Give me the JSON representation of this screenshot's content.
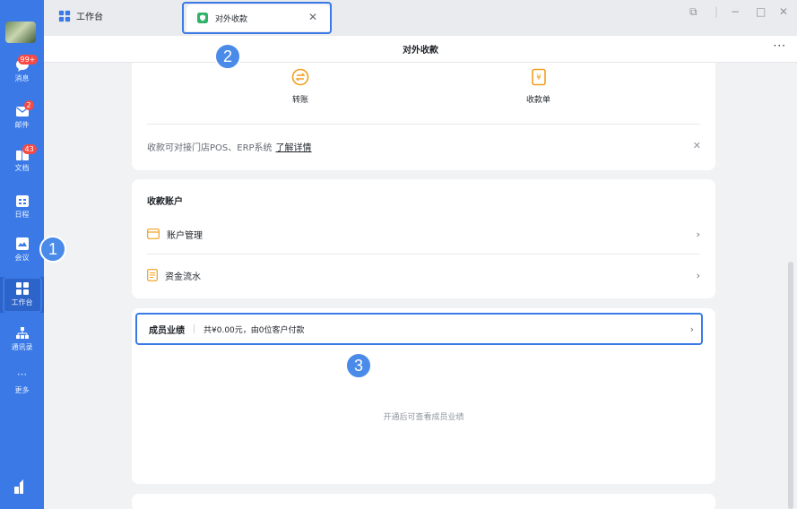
{
  "sidebar": {
    "items": [
      {
        "label": "消息",
        "badge": "99+",
        "icon": "message-icon"
      },
      {
        "label": "邮件",
        "badge": "2",
        "icon": "mail-icon"
      },
      {
        "label": "文档",
        "badge": "43",
        "icon": "docs-icon"
      },
      {
        "label": "日程",
        "badge": "",
        "icon": "calendar-icon"
      },
      {
        "label": "会议",
        "badge": "",
        "icon": "meeting-icon"
      },
      {
        "label": "工作台",
        "badge": "",
        "icon": "workbench-icon"
      },
      {
        "label": "通讯录",
        "badge": "",
        "icon": "contacts-icon"
      },
      {
        "label": "更多",
        "badge": "",
        "icon": "more-icon"
      }
    ]
  },
  "tabs": {
    "home": "工作台",
    "active": "对外收款"
  },
  "header": {
    "title": "对外收款",
    "more": "···"
  },
  "actions": [
    {
      "label": "转账",
      "icon": "transfer-icon"
    },
    {
      "label": "收款单",
      "icon": "receipt-icon"
    }
  ],
  "notice": {
    "text": "收款可对接门店POS、ERP系统",
    "link": "了解详情"
  },
  "account": {
    "title": "收款账户",
    "rows": [
      {
        "label": "账户管理",
        "icon": "account-card-icon"
      },
      {
        "label": "资金流水",
        "icon": "ledger-icon"
      }
    ]
  },
  "performance": {
    "title": "成员业绩",
    "summary": "共¥0.00元，由0位客户付款",
    "empty": "开通后可查看成员业绩"
  },
  "annotations": [
    "1",
    "2",
    "3"
  ],
  "colors": {
    "sidebar": "#3b7ae6",
    "accent": "#f0a020",
    "highlight": "#3b7ae6",
    "badge": "#f54a45"
  }
}
